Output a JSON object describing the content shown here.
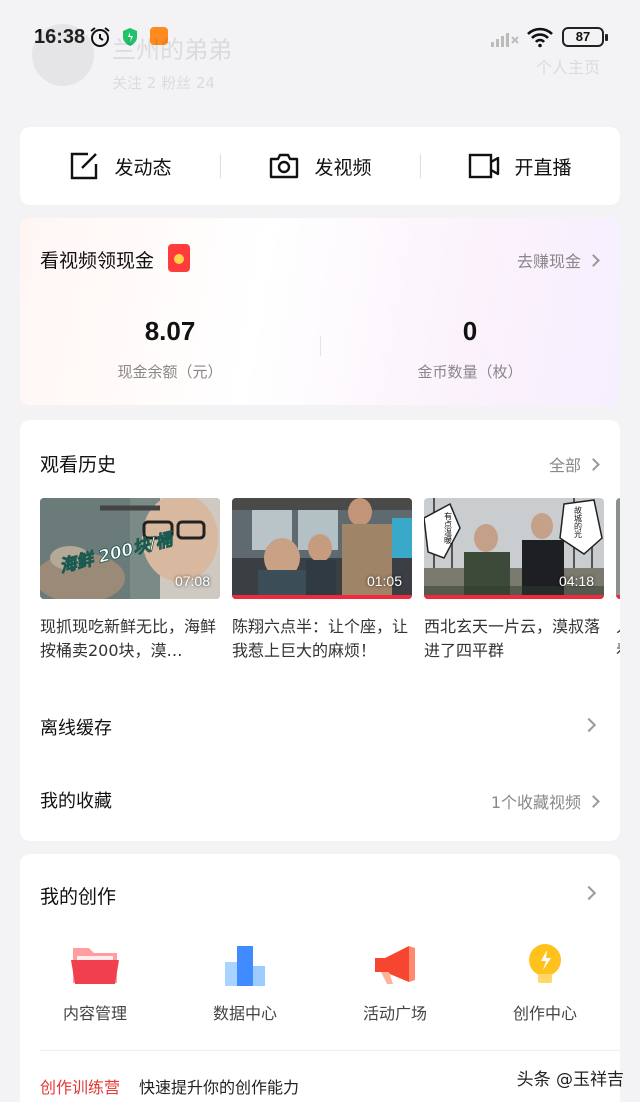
{
  "status_bar": {
    "time": "16:38",
    "battery": "87"
  },
  "profile": {
    "name": "兰州的弟弟",
    "stats": "关注 2     粉丝 24",
    "link": "个人主页"
  },
  "actions": [
    {
      "label": "发动态",
      "icon": "edit-icon"
    },
    {
      "label": "发视频",
      "icon": "camera-icon"
    },
    {
      "label": "开直播",
      "icon": "live-video-icon"
    }
  ],
  "cash": {
    "title": "看视频领现金",
    "link": "去赚现金",
    "balance_value": "8.07",
    "balance_label": "现金余额（元）",
    "coins_value": "0",
    "coins_label": "金币数量（枚）"
  },
  "history": {
    "title": "观看历史",
    "link": "全部",
    "videos": [
      {
        "title": "现抓现吃新鲜无比，海鲜按桶卖200块，漠…",
        "duration": "07:08",
        "overlay_text": "海鲜 200块/桶"
      },
      {
        "title": "陈翔六点半：让个座，让我惹上巨大的麻烦！",
        "duration": "01:05"
      },
      {
        "title": "西北玄天一片云，漠叔落进了四平群",
        "duration": "04:18",
        "bubble_left": "有点温暖",
        "bubble_right": "故城的光"
      }
    ],
    "partial_title": "人看"
  },
  "offline": {
    "label": "离线缓存"
  },
  "favorites": {
    "label": "我的收藏",
    "link": "1个收藏视频"
  },
  "create": {
    "title": "我的创作",
    "tools": [
      {
        "label": "内容管理",
        "icon": "folder-icon"
      },
      {
        "label": "数据中心",
        "icon": "bar-chart-icon"
      },
      {
        "label": "活动广场",
        "icon": "megaphone-icon"
      },
      {
        "label": "创作中心",
        "icon": "lightbulb-icon"
      }
    ],
    "camp_tag": "创作训练营",
    "camp_text": "快速提升你的创作能力"
  },
  "watermark": "头条 @玉祥吉"
}
